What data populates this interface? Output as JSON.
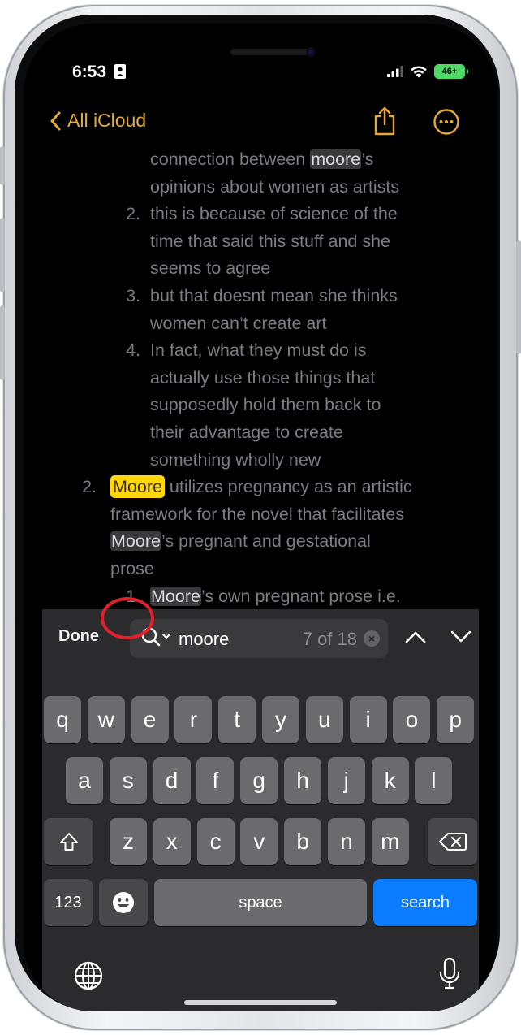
{
  "status": {
    "time": "6:53",
    "battery": "46+"
  },
  "nav": {
    "back_label": "All iCloud"
  },
  "note_lines": [
    {
      "num": "",
      "pre": "connection between ",
      "match": "moore",
      "post": "’s"
    },
    {
      "num": "",
      "text": "opinions about women as artists"
    },
    {
      "num": "2.",
      "text": "this is because of science of the"
    },
    {
      "num": "",
      "text": "time that said this stuff and she"
    },
    {
      "num": "",
      "text": "seems to agree"
    },
    {
      "num": "3.",
      "text": "but that doesnt mean she thinks"
    },
    {
      "num": "",
      "text": "women can’t create art"
    },
    {
      "num": "4.",
      "text": "In fact, what they must do is"
    },
    {
      "num": "",
      "text": "actually use those things that"
    },
    {
      "num": "",
      "text": "supposedly hold them back to"
    },
    {
      "num": "",
      "text": "their advantage to create"
    },
    {
      "num": "",
      "text": "something wholly new"
    },
    {
      "num": "2.",
      "current": "Moore",
      "post": " utilizes pregnancy as an artistic"
    },
    {
      "num": "",
      "text": "framework for the novel that facilitates"
    },
    {
      "num": "",
      "match": "Moore",
      "post": "’s pregnant and gestational"
    },
    {
      "num": "",
      "text": "prose"
    },
    {
      "num": "1.",
      "match": "Moore",
      "post": "’s own pregnant prose i.e."
    }
  ],
  "findbar": {
    "done_label": "Done",
    "query": "moore",
    "match_count": "7 of 18",
    "clear_glyph": "×"
  },
  "keyboard": {
    "row1": [
      "q",
      "w",
      "e",
      "r",
      "t",
      "y",
      "u",
      "i",
      "o",
      "p"
    ],
    "row2": [
      "a",
      "s",
      "d",
      "f",
      "g",
      "h",
      "j",
      "k",
      "l"
    ],
    "row3": [
      "z",
      "x",
      "c",
      "v",
      "b",
      "n",
      "m"
    ],
    "numbers_label": "123",
    "space_label": "space",
    "search_label": "search"
  },
  "colors": {
    "accent": "#e5a93a",
    "match_current": "#ffd60a",
    "search_key": "#0a7cff",
    "annotation": "#e0202a"
  },
  "icons": [
    "share-icon",
    "more-icon",
    "chevron-left-icon",
    "search-icon",
    "chevron-up-icon",
    "chevron-down-icon",
    "shift-icon",
    "delete-icon",
    "emoji-icon",
    "globe-icon",
    "mic-icon"
  ]
}
